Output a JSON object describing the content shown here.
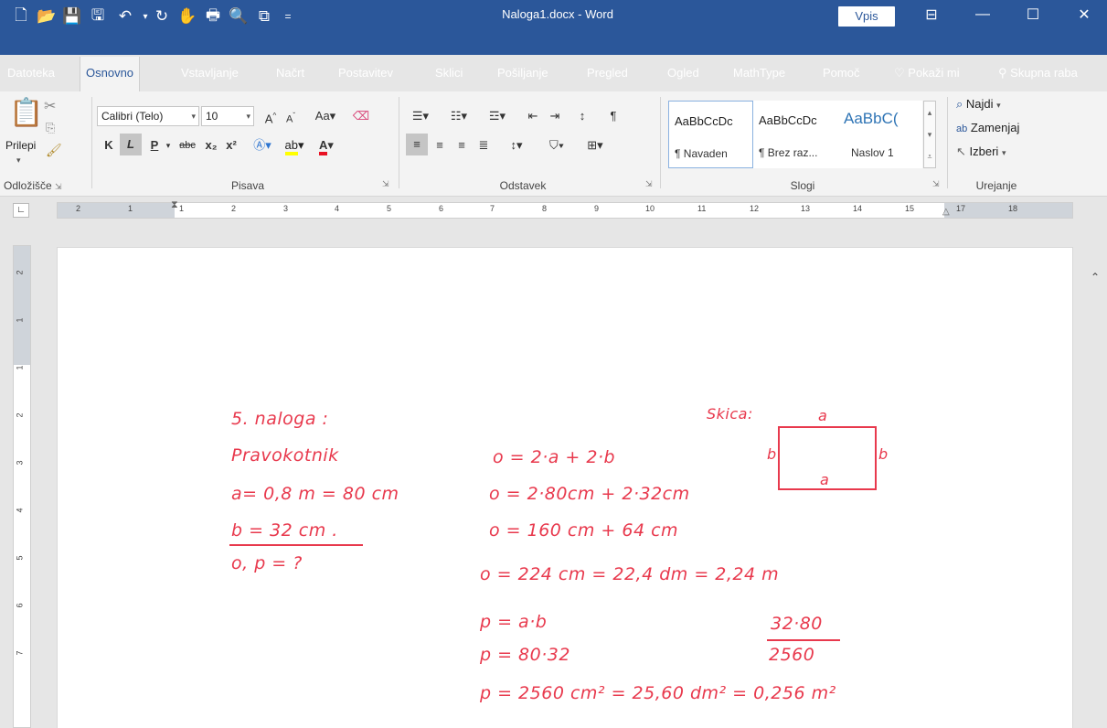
{
  "window": {
    "title": "Naloga1.docx - Word",
    "signin_label": "Vpis"
  },
  "tabs": [
    "Datoteka",
    "Osnovno",
    "Vstavljanje",
    "Načrt",
    "Postavitev",
    "Sklici",
    "Pošiljanje",
    "Pregled",
    "Ogled",
    "MathType",
    "Pomoč"
  ],
  "tellme": "Pokaži mi",
  "share": "Skupna raba",
  "ribbon": {
    "clipboard": {
      "paste": "Prilepi",
      "label": "Odložišče"
    },
    "font": {
      "name": "Calibri (Telo)",
      "size": "10",
      "bold": "K",
      "italic": "L",
      "underline": "P",
      "label": "Pisava"
    },
    "paragraph": {
      "label": "Odstavek"
    },
    "styles": {
      "label": "Slogi",
      "items": [
        {
          "preview": "AaBbCcDc",
          "name": "¶ Navaden"
        },
        {
          "preview": "AaBbCcDc",
          "name": "¶ Brez raz..."
        },
        {
          "preview": "AaBbC(",
          "name": "Naslov 1"
        }
      ]
    },
    "editing": {
      "find": "Najdi",
      "replace": "Zamenjaj",
      "select": "Izberi",
      "label": "Urejanje"
    }
  },
  "ruler": {
    "h_ticks": [
      "2",
      "1",
      "1",
      "2",
      "3",
      "4",
      "5",
      "6",
      "7",
      "8",
      "9",
      "10",
      "11",
      "12",
      "13",
      "14",
      "15",
      "17",
      "18"
    ],
    "v_ticks": [
      "2",
      "1",
      "1",
      "2",
      "3",
      "4",
      "5",
      "6",
      "7"
    ]
  },
  "document": {
    "task_title": "5. naloga :",
    "shape": "Pravokotnik",
    "given_a": "a= 0,8 m = 80 cm",
    "given_b": "b = 32 cm .",
    "unknowns": "o, p = ?",
    "sketch_label": "Skica:",
    "sketch_a_top": "a",
    "sketch_a_bottom": "a",
    "sketch_b_left": "b",
    "sketch_b_right": "b",
    "perim_formula": "o = 2·a + 2·b",
    "perim_subst": "o = 2·80cm + 2·32cm",
    "perim_sum": "o = 160 cm + 64 cm",
    "perim_result": "o = 224 cm = 22,4 dm = 2,24 m",
    "area_formula": "p = a·b",
    "area_subst": "p = 80·32",
    "area_result": "p = 2560 cm² = 25,60 dm² = 0,256 m²",
    "side_calc_top": "32·80",
    "side_calc_bottom": "2560"
  },
  "colors": {
    "accent": "#2b579a",
    "ink": "#e8394d"
  }
}
